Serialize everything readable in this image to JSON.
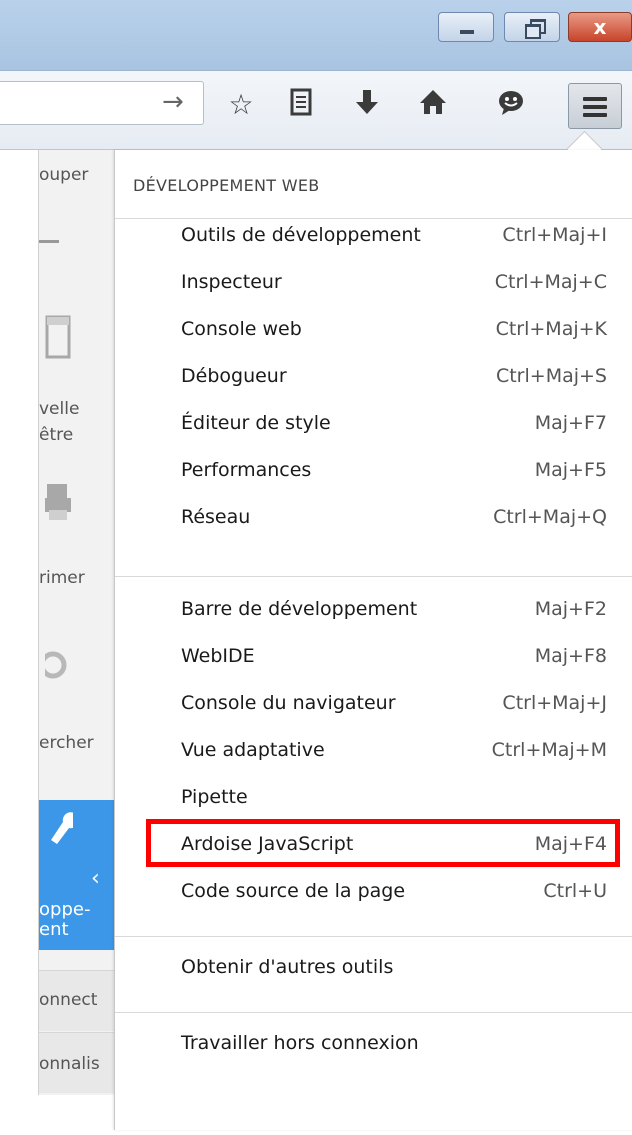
{
  "window": {
    "close_glyph": "x"
  },
  "toolbar": {
    "go_arrow": "→",
    "icons": [
      "star-icon",
      "reading-list-icon",
      "download-icon",
      "home-icon",
      "chat-icon",
      "hamburger-menu-icon"
    ]
  },
  "main_panel": {
    "partial_labels": {
      "copy": "ouper",
      "new_window_1": "velle",
      "new_window_2": "être",
      "print": "rimer",
      "find": "ercher",
      "developer_1": "oppe-",
      "developer_2": "ent",
      "connect": "onnect",
      "customize": "onnalis"
    },
    "developer_color": "#3d97e8"
  },
  "dropdown": {
    "title": "DÉVELOPPEMENT WEB",
    "group1": [
      {
        "label": "Outils de développement",
        "shortcut": "Ctrl+Maj+I"
      },
      {
        "label": "Inspecteur",
        "shortcut": "Ctrl+Maj+C"
      },
      {
        "label": "Console web",
        "shortcut": "Ctrl+Maj+K"
      },
      {
        "label": "Débogueur",
        "shortcut": "Ctrl+Maj+S"
      },
      {
        "label": "Éditeur de style",
        "shortcut": "Maj+F7"
      },
      {
        "label": "Performances",
        "shortcut": "Maj+F5"
      },
      {
        "label": "Réseau",
        "shortcut": "Ctrl+Maj+Q"
      }
    ],
    "group2": [
      {
        "label": "Barre de développement",
        "shortcut": "Maj+F2"
      },
      {
        "label": "WebIDE",
        "shortcut": "Maj+F8"
      },
      {
        "label": "Console du navigateur",
        "shortcut": "Ctrl+Maj+J"
      },
      {
        "label": "Vue adaptative",
        "shortcut": "Ctrl+Maj+M"
      },
      {
        "label": "Pipette",
        "shortcut": ""
      },
      {
        "label": "Ardoise JavaScript",
        "shortcut": "Maj+F4"
      },
      {
        "label": "Code source de la page",
        "shortcut": "Ctrl+U"
      }
    ],
    "group3": [
      {
        "label": "Obtenir d'autres outils",
        "shortcut": ""
      }
    ],
    "group4": [
      {
        "label": "Travailler hors connexion",
        "shortcut": ""
      }
    ]
  },
  "highlight_color": "#ff0000"
}
